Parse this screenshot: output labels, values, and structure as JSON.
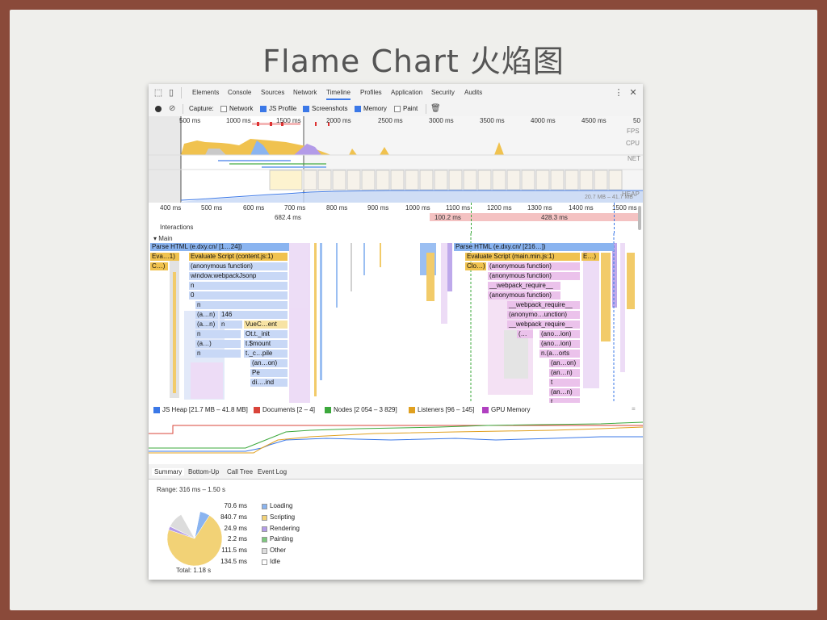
{
  "slide": {
    "title": "Flame Chart 火焰图"
  },
  "devtools": {
    "tabs": [
      "Elements",
      "Console",
      "Sources",
      "Network",
      "Timeline",
      "Profiles",
      "Application",
      "Security",
      "Audits"
    ],
    "active_tab": "Timeline",
    "capture_label": "Capture:",
    "capture_options": [
      {
        "label": "Network",
        "checked": false
      },
      {
        "label": "JS Profile",
        "checked": true
      },
      {
        "label": "Screenshots",
        "checked": true
      },
      {
        "label": "Memory",
        "checked": true
      },
      {
        "label": "Paint",
        "checked": false
      }
    ],
    "overview": {
      "ticks": [
        "500 ms",
        "1000 ms",
        "1500 ms",
        "2000 ms",
        "2500 ms",
        "3000 ms",
        "3500 ms",
        "4000 ms",
        "4500 ms",
        "50"
      ],
      "labels": [
        "FPS",
        "CPU",
        "NET",
        "HEAP"
      ],
      "heap_range": "20.7 MB – 41.7 MB"
    },
    "ruler": {
      "ticks": [
        "400 ms",
        "500 ms",
        "600 ms",
        "700 ms",
        "800 ms",
        "900 ms",
        "1000 ms",
        "1100 ms",
        "1200 ms",
        "1300 ms",
        "1400 ms",
        "1500 ms"
      ],
      "interaction_1": "682.4 ms",
      "interaction_2": "100.2 ms",
      "interaction_3": "428.3 ms",
      "interactions_label": "Interactions"
    },
    "main_label": "Main",
    "flame": {
      "left": [
        "Parse HTML (e.dxy.cn/ [1…24])",
        "Evaluate Script (content.js:1)",
        "(anonymous function)",
        "window.webpackJsonp",
        "n",
        "0",
        "n",
        "(a…n)",
        "146",
        "(a…n)",
        "n",
        "VueC…ent",
        "n",
        "Ot.t._init",
        "(a…)",
        "t.$mount",
        "n",
        "t._c…pile",
        "(an…on)",
        "Pe",
        "di….ind",
        "Eva…1)",
        "C…)"
      ],
      "right": [
        "Parse HTML (e.dxy.cn/ [216…])",
        "Evaluate Script (main.min.js:1)",
        "E…)",
        "Clo…)",
        "(anonymous function)",
        "(anonymous function)",
        "__webpack_require__",
        "(anonymous function)",
        "__webpack_require__",
        "(anonymo…unction)",
        "__webpack_require__",
        "(…",
        "(ano…ion)",
        "(ano…ion)",
        "n.(a…orts",
        "(an…on)",
        "(an…n)",
        "t",
        "(an…n)",
        "t"
      ]
    },
    "counters": [
      {
        "label": "JS Heap [21.7 MB – 41.8 MB]",
        "color": "#3b78e7"
      },
      {
        "label": "Documents [2 – 4]",
        "color": "#d9443a"
      },
      {
        "label": "Nodes [2 054 – 3 829]",
        "color": "#3ca83c"
      },
      {
        "label": "Listeners [96 – 145]",
        "color": "#e0a020"
      },
      {
        "label": "GPU Memory",
        "color": "#b040c0"
      }
    ],
    "summary_tabs": [
      "Summary",
      "Bottom-Up",
      "Call Tree",
      "Event Log"
    ],
    "range": "Range: 316 ms – 1.50 s",
    "breakdown": [
      {
        "value": "70.6 ms",
        "label": "Loading",
        "color": "#8ab4f0"
      },
      {
        "value": "840.7 ms",
        "label": "Scripting",
        "color": "#f2d276"
      },
      {
        "value": "24.9 ms",
        "label": "Rendering",
        "color": "#b39be8"
      },
      {
        "value": "2.2 ms",
        "label": "Painting",
        "color": "#7cc87c"
      },
      {
        "value": "111.5 ms",
        "label": "Other",
        "color": "#dcdcdc"
      },
      {
        "value": "134.5 ms",
        "label": "Idle",
        "color": "#ffffff"
      }
    ],
    "total": "Total: 1.18 s"
  }
}
